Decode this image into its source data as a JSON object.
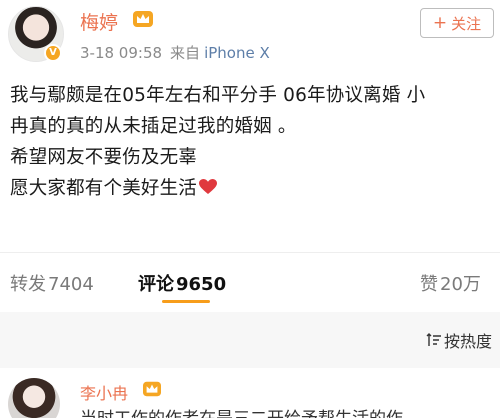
{
  "post": {
    "author": "梅婷",
    "timestamp": "3-18 09:58",
    "source_label": "来自",
    "device": "iPhone X",
    "follow_label": "关注",
    "body_lines": [
      "我与鄢颇是在05年左右和平分手  06年协议离婚 小",
      "冉真的真的从未插足过我的婚姻 。",
      "希望网友不要伤及无辜",
      "愿大家都有个美好生活"
    ]
  },
  "actions": {
    "repost_label": "转发",
    "repost_count": "7404",
    "comment_label": "评论",
    "comment_count": "9650",
    "like_label": "赞",
    "like_count": "20万"
  },
  "sort": {
    "label": "按热度"
  },
  "comment": {
    "author": "李小冉",
    "text": "当时工作的作者在是三二开给予帮生活的作"
  },
  "colors": {
    "accent": "#eb7350",
    "tab_underline": "#f79d1b",
    "badge": "#f5a623",
    "heart": "#e0393e"
  },
  "icons": [
    "verified-badge-icon",
    "crown-icon",
    "plus-icon",
    "heart-icon",
    "sort-icon"
  ]
}
